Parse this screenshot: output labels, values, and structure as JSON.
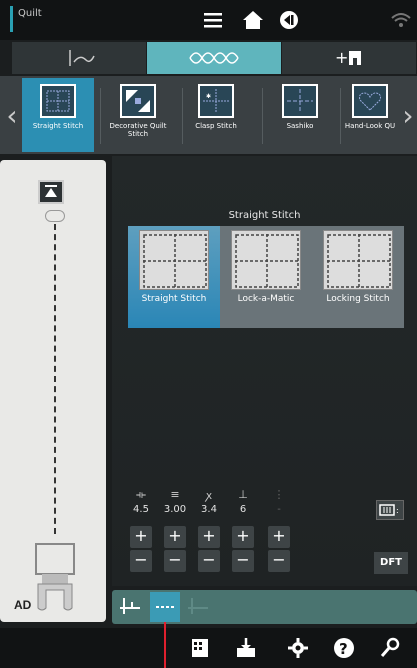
{
  "topbar": {
    "title": "Quilt"
  },
  "categories": [
    "stitch-decor-tab",
    "quilt-tab",
    "add-tab"
  ],
  "stitch_strip": {
    "items": [
      {
        "label": "Straight Stitch",
        "active": true
      },
      {
        "label": "Decorative Quilt Stitch",
        "active": false
      },
      {
        "label": "Clasp Stitch",
        "active": false
      },
      {
        "label": "Sashiko",
        "active": false
      },
      {
        "label": "Hand-Look QU",
        "active": false
      }
    ]
  },
  "selection": {
    "title": "Straight Stitch",
    "options": [
      {
        "label": "Straight Stitch",
        "active": true
      },
      {
        "label": "Lock-a-Matic",
        "active": false
      },
      {
        "label": "Locking Stitch",
        "active": false
      }
    ]
  },
  "settings": {
    "values": [
      "4.5",
      "3.00",
      "3.4",
      "6",
      "-"
    ],
    "plus": "+",
    "minus": "−"
  },
  "left_panel": {
    "foot_label": "AD"
  },
  "right_buttons": {
    "dft_label": "DFT"
  },
  "colors": {
    "accent": "#2aa0b3",
    "active_tab": "#5fb5bd",
    "active_item": "#2c8fb3",
    "marker": "#e0202e"
  }
}
